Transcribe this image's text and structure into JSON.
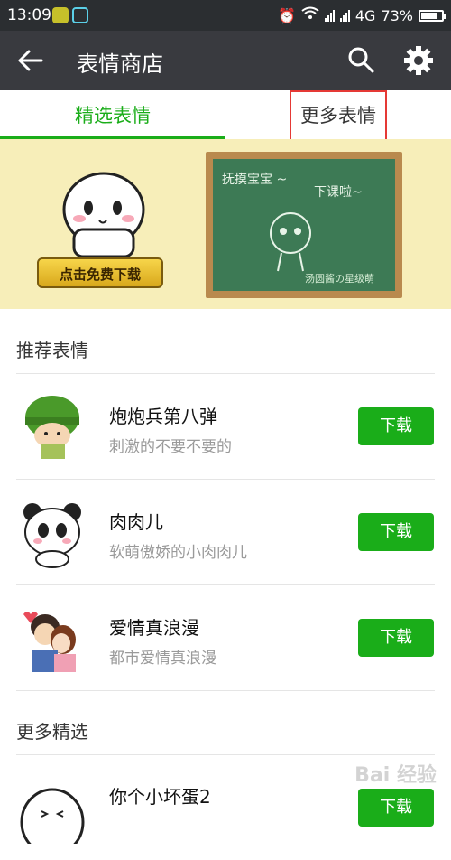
{
  "status_bar": {
    "time": "13:09",
    "network": "4G",
    "battery": "73%"
  },
  "app_bar": {
    "title": "表情商店"
  },
  "tabs": [
    {
      "label": "精选表情"
    },
    {
      "label": "更多表情"
    }
  ],
  "banner": {
    "button_label": "点击免费下载",
    "board_text_1": "抚摸宝宝 ~",
    "board_text_2": "下课啦~",
    "board_signature": "汤圆酱の星级萌"
  },
  "recommended": {
    "title": "推荐表情",
    "items": [
      {
        "name": "炮炮兵第八弹",
        "desc": "刺激的不要不要的",
        "button": "下载"
      },
      {
        "name": "肉肉儿",
        "desc": "软萌傲娇的小肉肉儿",
        "button": "下载"
      },
      {
        "name": "爱情真浪漫",
        "desc": "都市爱情真浪漫",
        "button": "下载"
      }
    ]
  },
  "more": {
    "title": "更多精选",
    "items": [
      {
        "name": "你个小坏蛋2",
        "button": "下载"
      }
    ]
  },
  "watermark": "Bai 经验",
  "colors": {
    "accent": "#1aad19",
    "appbar": "#393a3f",
    "statusbar": "#2b2e31",
    "banner_bg": "#f7eeb9",
    "highlight": "#e53935"
  }
}
